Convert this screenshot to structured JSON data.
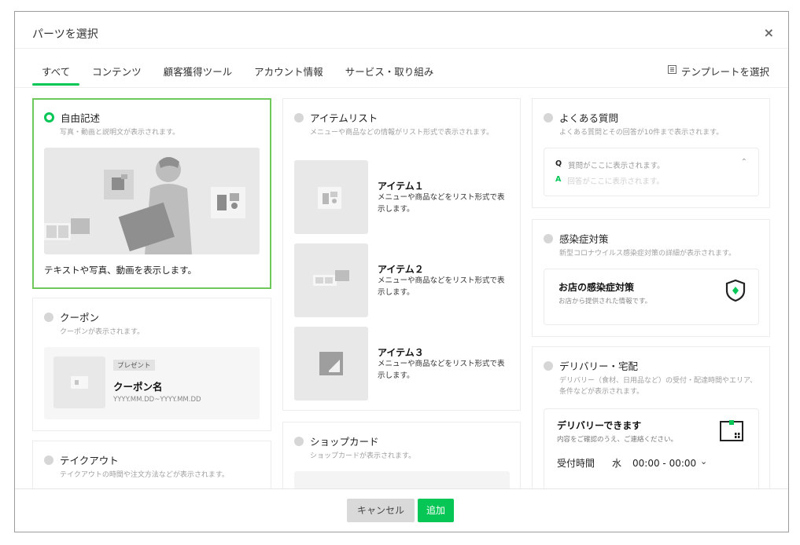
{
  "dialog": {
    "title": "パーツを選択",
    "close": "×",
    "template_select": "テンプレートを選択"
  },
  "tabs": [
    {
      "label": "すべて",
      "active": true
    },
    {
      "label": "コンテンツ"
    },
    {
      "label": "顧客獲得ツール"
    },
    {
      "label": "アカウント情報"
    },
    {
      "label": "サービス・取り組み"
    }
  ],
  "cards": {
    "free": {
      "title": "自由記述",
      "desc": "写真・動画と説明文が表示されます。",
      "caption": "テキストや写真、動画を表示します。"
    },
    "coupon": {
      "title": "クーポン",
      "desc": "クーポンが表示されます。",
      "badge": "プレゼント",
      "name": "クーポン名",
      "period": "YYYY.MM.DD~YYYY.MM.DD"
    },
    "takeout": {
      "title": "テイクアウト",
      "desc": "テイクアウトの時間や注文方法などが表示されます。"
    },
    "item_list": {
      "title": "アイテムリスト",
      "desc": "メニューや商品などの情報がリスト形式で表示されます。",
      "items": [
        {
          "name": "アイテム１",
          "desc": "メニューや商品などをリスト形式で表示します。"
        },
        {
          "name": "アイテム２",
          "desc": "メニューや商品などをリスト形式で表示します。"
        },
        {
          "name": "アイテム３",
          "desc": "メニューや商品などをリスト形式で表示します。"
        }
      ]
    },
    "shop_card": {
      "title": "ショップカード",
      "desc": "ショップカードが表示されます。"
    },
    "faq": {
      "title": "よくある質問",
      "desc": "よくある質問とその回答が10件まで表示されます。",
      "q_mark": "Q",
      "q_text": "質問がここに表示されます。",
      "a_mark": "A",
      "a_text": "回答がここに表示されます。"
    },
    "infection": {
      "title": "感染症対策",
      "desc": "新型コロナウイルス感染症対策の詳細が表示されます。",
      "box_title": "お店の感染症対策",
      "box_desc": "お店から提供された情報です。"
    },
    "delivery": {
      "title": "デリバリー・宅配",
      "desc": "デリバリー（食材、日用品など）の受付・配達時間やエリア、条件などが表示されます。",
      "box_title": "デリバリーできます",
      "box_desc": "内容をご確認のうえ、ご連絡ください。",
      "hours_label": "受付時間",
      "day": "水",
      "time": "00:00 - 00:00"
    }
  },
  "footer": {
    "cancel": "キャンセル",
    "add": "追加"
  },
  "colors": {
    "accent": "#06c755",
    "selected_border": "#6fc85b"
  }
}
